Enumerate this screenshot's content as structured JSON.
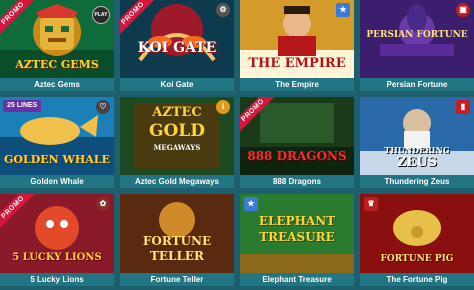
{
  "badges": {
    "promo": "PROMO",
    "play": "PLAY",
    "lines": "25 LINES"
  },
  "games": [
    {
      "title": "Aztec Gems",
      "logo": "AZTEC GEMS"
    },
    {
      "title": "Koi Gate",
      "logo": "KOI GATE"
    },
    {
      "title": "The Empire",
      "logo": "THE EMPIRE"
    },
    {
      "title": "Persian Fortune",
      "logo": "PERSIAN FORTUNE"
    },
    {
      "title": "Golden Whale",
      "logo": "GOLDEN WHALE"
    },
    {
      "title": "Aztec Gold Megaways",
      "logo_line1": "AZTEC",
      "logo_line2": "GOLD",
      "logo_line3": "MEGAWAYS"
    },
    {
      "title": "888 Dragons",
      "logo": "888 DRAGONS"
    },
    {
      "title": "Thundering Zeus",
      "logo_line1": "THUNDERING",
      "logo_line2": "ZEUS"
    },
    {
      "title": "5 Lucky Lions",
      "logo": "5 LUCKY LIONS"
    },
    {
      "title": "Fortune Teller",
      "logo_line1": "FORTUNE",
      "logo_line2": "TELLER"
    },
    {
      "title": "Elephant Treasure",
      "logo_line1": "ELEPHANT",
      "logo_line2": "TREASURE"
    },
    {
      "title": "The Fortune Pig",
      "logo": "FORTUNE PIG"
    }
  ],
  "colors": {
    "background": "#1d5f6c",
    "caption": "#227583",
    "promo": "#d6163d"
  }
}
